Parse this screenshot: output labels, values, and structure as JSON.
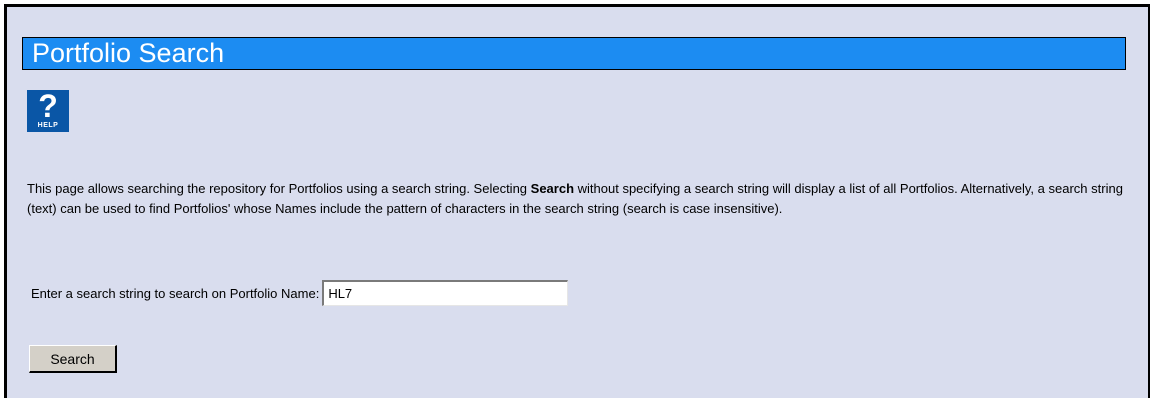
{
  "page": {
    "title": "Portfolio Search"
  },
  "help": {
    "glyph": "?",
    "label": "HELP",
    "icon": "help-icon"
  },
  "description": {
    "part1": "This page allows searching the repository for Portfolios using a search string. Selecting ",
    "bold": "Search",
    "part2": " without specifying a search string will display a list of all Portfolios. Alternatively, a search string (text) can be used to find Portfolios' whose Names include the pattern of characters in the search string (search is case insensitive)."
  },
  "search": {
    "label": "Enter a search string to search on Portfolio Name:",
    "value": "HL7",
    "button_label": "Search"
  },
  "colors": {
    "background": "#d9ddee",
    "title_bar": "#1c8cf2",
    "help_icon": "#0a56a6",
    "button": "#d4d0c8"
  }
}
